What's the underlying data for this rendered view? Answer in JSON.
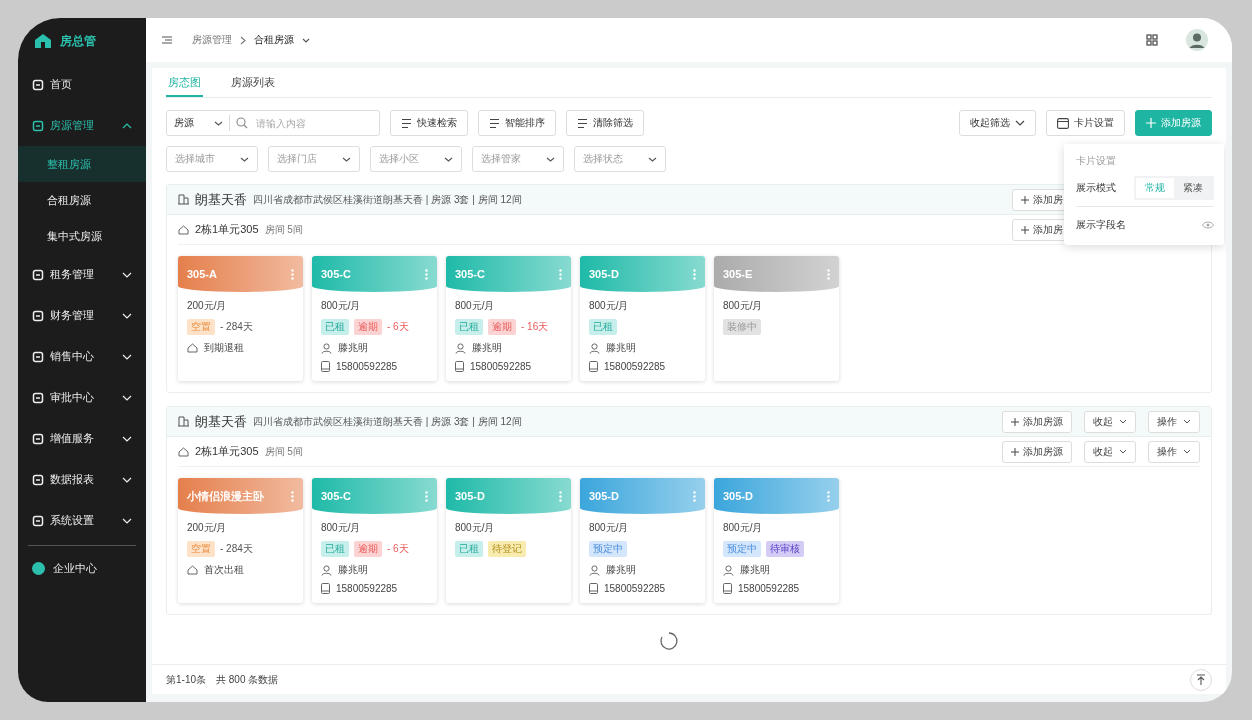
{
  "brand": {
    "name": "房总管"
  },
  "sidebar": {
    "items": [
      {
        "label": "首页",
        "expanded": false,
        "selected": false
      },
      {
        "label": "房源管理",
        "expanded": true,
        "selected": false,
        "children": [
          {
            "label": "整租房源",
            "selected": true
          },
          {
            "label": "合租房源",
            "selected": false
          },
          {
            "label": "集中式房源",
            "selected": false
          }
        ]
      },
      {
        "label": "租务管理",
        "expanded": false,
        "selected": false
      },
      {
        "label": "财务管理",
        "expanded": false,
        "selected": false
      },
      {
        "label": "销售中心",
        "expanded": false,
        "selected": false
      },
      {
        "label": "审批中心",
        "expanded": false,
        "selected": false
      },
      {
        "label": "增值服务",
        "expanded": false,
        "selected": false
      },
      {
        "label": "数据报表",
        "expanded": false,
        "selected": false
      },
      {
        "label": "系统设置",
        "expanded": false,
        "selected": false
      }
    ],
    "footer_item": {
      "label": "企业中心"
    }
  },
  "breadcrumb": [
    "房源管理",
    "合租房源"
  ],
  "tabs": [
    {
      "label": "房态图",
      "selected": true
    },
    {
      "label": "房源列表",
      "selected": false
    }
  ],
  "search": {
    "scope": "房源",
    "placeholder": "请输入内容"
  },
  "tool_buttons": [
    {
      "label": "快速检索"
    },
    {
      "label": "智能排序"
    },
    {
      "label": "清除筛选"
    }
  ],
  "filters": [
    "选择城市",
    "选择门店",
    "选择小区",
    "选择管家",
    "选择状态"
  ],
  "right_buttons": {
    "collapse": "收起筛选",
    "card_settings": "卡片设置",
    "add": "添加房源"
  },
  "card_settings_popup": {
    "title": "卡片设置",
    "mode_label": "展示模式",
    "modes": [
      {
        "label": "常规",
        "selected": true
      },
      {
        "label": "紧凑",
        "selected": false
      }
    ],
    "field_label": "展示字段名"
  },
  "groups": [
    {
      "name": "朗基天香",
      "info": "四川省成都市武侯区桂溪街道朗基天香 | 房源 3套 | 房间 12间",
      "header_buttons": {
        "add": "添加房"
      },
      "unit": {
        "name": "2栋1单元305",
        "rooms": "房间 5间",
        "buttons": {
          "add": "添加房"
        }
      },
      "cards": [
        {
          "title": "305-A",
          "color": "#e57f4c",
          "price": "200元/月",
          "tags": [
            {
              "label": "空置",
              "kind": "vacant"
            }
          ],
          "suffix": "- 284天",
          "suffix_alert": false,
          "lines": [
            {
              "kind": "home",
              "text": "到期退租"
            }
          ]
        },
        {
          "title": "305-C",
          "color": "#1fbaa8",
          "price": "800元/月",
          "tags": [
            {
              "label": "已租",
              "kind": "rented"
            },
            {
              "label": "逾期",
              "kind": "overdue"
            }
          ],
          "suffix": "- 6天",
          "suffix_alert": true,
          "lines": [
            {
              "kind": "person",
              "text": "滕兆明"
            },
            {
              "kind": "phone",
              "text": "15800592285"
            }
          ]
        },
        {
          "title": "305-C",
          "color": "#1fbaa8",
          "price": "800元/月",
          "tags": [
            {
              "label": "已租",
              "kind": "rented"
            },
            {
              "label": "逾期",
              "kind": "overdue"
            }
          ],
          "suffix": "- 16天",
          "suffix_alert": true,
          "lines": [
            {
              "kind": "person",
              "text": "滕兆明"
            },
            {
              "kind": "phone",
              "text": "15800592285"
            }
          ]
        },
        {
          "title": "305-D",
          "color": "#1fbaa8",
          "price": "800元/月",
          "tags": [
            {
              "label": "已租",
              "kind": "rented"
            }
          ],
          "lines": [
            {
              "kind": "person",
              "text": "滕兆明"
            },
            {
              "kind": "phone",
              "text": "15800592285"
            }
          ]
        },
        {
          "title": "305-E",
          "color": "#ababab",
          "price": "800元/月",
          "tags": [
            {
              "label": "装修中",
              "kind": "renovating"
            }
          ]
        }
      ]
    },
    {
      "name": "朗基天香",
      "info": "四川省成都市武侯区桂溪街道朗基天香 | 房源 3套 | 房间 12间",
      "header_buttons": {
        "add": "添加房源",
        "collapse": "收起",
        "action": "操作"
      },
      "unit": {
        "name": "2栋1单元305",
        "rooms": "房间 5间",
        "buttons": {
          "add": "添加房源",
          "collapse": "收起",
          "action": "操作"
        }
      },
      "cards": [
        {
          "title": "小情侣浪漫主卧",
          "color": "#e57f4c",
          "price": "200元/月",
          "tags": [
            {
              "label": "空置",
              "kind": "vacant"
            }
          ],
          "suffix": "- 284天",
          "suffix_alert": false,
          "lines": [
            {
              "kind": "home",
              "text": "首次出租"
            }
          ]
        },
        {
          "title": "305-C",
          "color": "#1fbaa8",
          "price": "800元/月",
          "tags": [
            {
              "label": "已租",
              "kind": "rented"
            },
            {
              "label": "逾期",
              "kind": "overdue"
            }
          ],
          "suffix": "- 6天",
          "suffix_alert": true,
          "lines": [
            {
              "kind": "person",
              "text": "滕兆明"
            },
            {
              "kind": "phone",
              "text": "15800592285"
            }
          ]
        },
        {
          "title": "305-D",
          "color": "#1fbaa8",
          "price": "800元/月",
          "tags": [
            {
              "label": "已租",
              "kind": "rented"
            },
            {
              "label": "待登记",
              "kind": "pending"
            }
          ]
        },
        {
          "title": "305-D",
          "color": "#3ba6dc",
          "price": "800元/月",
          "tags": [
            {
              "label": "预定中",
              "kind": "reserved"
            }
          ],
          "lines": [
            {
              "kind": "person",
              "text": "滕兆明"
            },
            {
              "kind": "phone",
              "text": "15800592285"
            }
          ]
        },
        {
          "title": "305-D",
          "color": "#3ba6dc",
          "price": "800元/月",
          "tags": [
            {
              "label": "预定中",
              "kind": "reserved"
            },
            {
              "label": "待审核",
              "kind": "review"
            }
          ],
          "lines": [
            {
              "kind": "person",
              "text": "滕兆明"
            },
            {
              "kind": "phone",
              "text": "15800592285"
            }
          ]
        }
      ]
    }
  ],
  "footer": {
    "range": "第1-10条",
    "total": "共 800 条数据"
  }
}
